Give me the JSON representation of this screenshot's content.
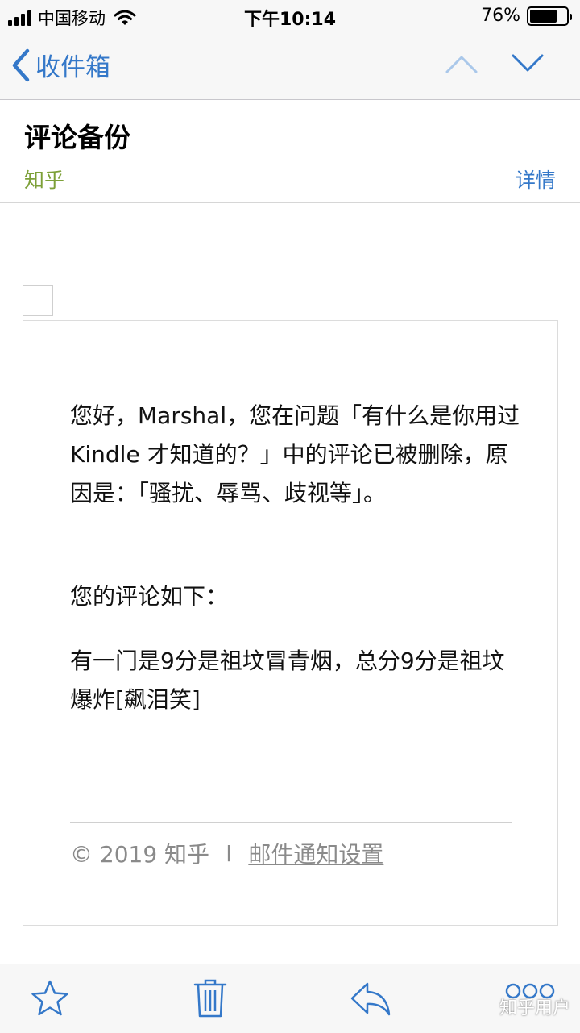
{
  "status_bar": {
    "carrier": "中国移动",
    "time": "下午10:14",
    "battery": "76%",
    "battery_level": 0.76
  },
  "nav": {
    "back_label": "收件箱",
    "accent_color": "#3478c9"
  },
  "header": {
    "subject": "评论备份",
    "sender": "知乎",
    "details_label": "详情"
  },
  "body": {
    "paragraph1": "您好，Marshal，您在问题「有什么是你用过 Kindle 才知道的？」中的评论已被删除，原因是：「骚扰、辱骂、歧视等」。",
    "paragraph2": "您的评论如下：",
    "paragraph3": "有一门是9分是祖坟冒青烟，总分9分是祖坟爆炸[飙泪笑]",
    "footer_copyright": "© 2019 知乎",
    "footer_separator": "I",
    "footer_link": "邮件通知设置"
  },
  "toolbar": {
    "icons": [
      "star-icon",
      "trash-icon",
      "reply-icon",
      "more-icon"
    ]
  },
  "watermark": "知乎用户"
}
